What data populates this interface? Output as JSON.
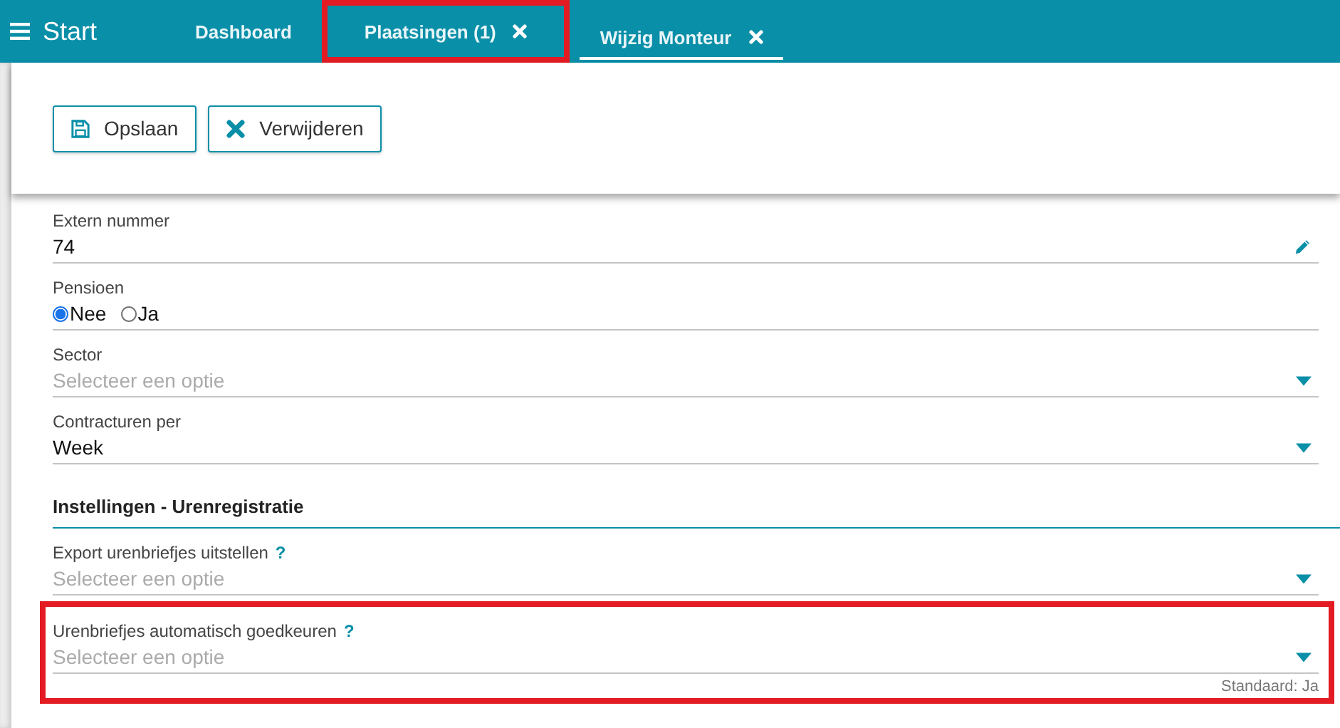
{
  "topbar": {
    "menu_label": "Start",
    "tabs": [
      {
        "label": "Dashboard",
        "selected": false,
        "closable": false,
        "highlighted": false
      },
      {
        "label": "Plaatsingen (1)",
        "selected": false,
        "closable": true,
        "highlighted": true
      },
      {
        "label": "Wijzig Monteur",
        "selected": true,
        "closable": true,
        "highlighted": false
      }
    ]
  },
  "toolbar": {
    "buttons": [
      {
        "label": "Opslaan",
        "kind": "save"
      },
      {
        "label": "Verwijderen",
        "kind": "delete"
      }
    ]
  },
  "fields": [
    {
      "kind": "text",
      "label": "Extern nummer",
      "value": "74",
      "editable": true,
      "highlighted": false
    },
    {
      "kind": "radio",
      "label": "Pensioen",
      "options": [
        {
          "label": "Nee",
          "selected": true
        },
        {
          "label": "Ja",
          "selected": false
        }
      ],
      "highlighted": false
    },
    {
      "kind": "select",
      "label": "Sector",
      "placeholder": "Selecteer een optie",
      "highlighted": false
    },
    {
      "kind": "select",
      "label": "Contracturen per",
      "value": "Week",
      "highlighted": false
    },
    {
      "kind": "section",
      "label": "Instellingen - Urenregistratie"
    },
    {
      "kind": "select",
      "label": "Export urenbriefjes uitstellen",
      "placeholder": "Selecteer een optie",
      "help": "?",
      "highlighted": false
    },
    {
      "kind": "select",
      "label": "Urenbriefjes automatisch goedkeuren",
      "placeholder": "Selecteer een optie",
      "help": "?",
      "default_note": "Standaard: Ja",
      "highlighted": true
    }
  ]
}
